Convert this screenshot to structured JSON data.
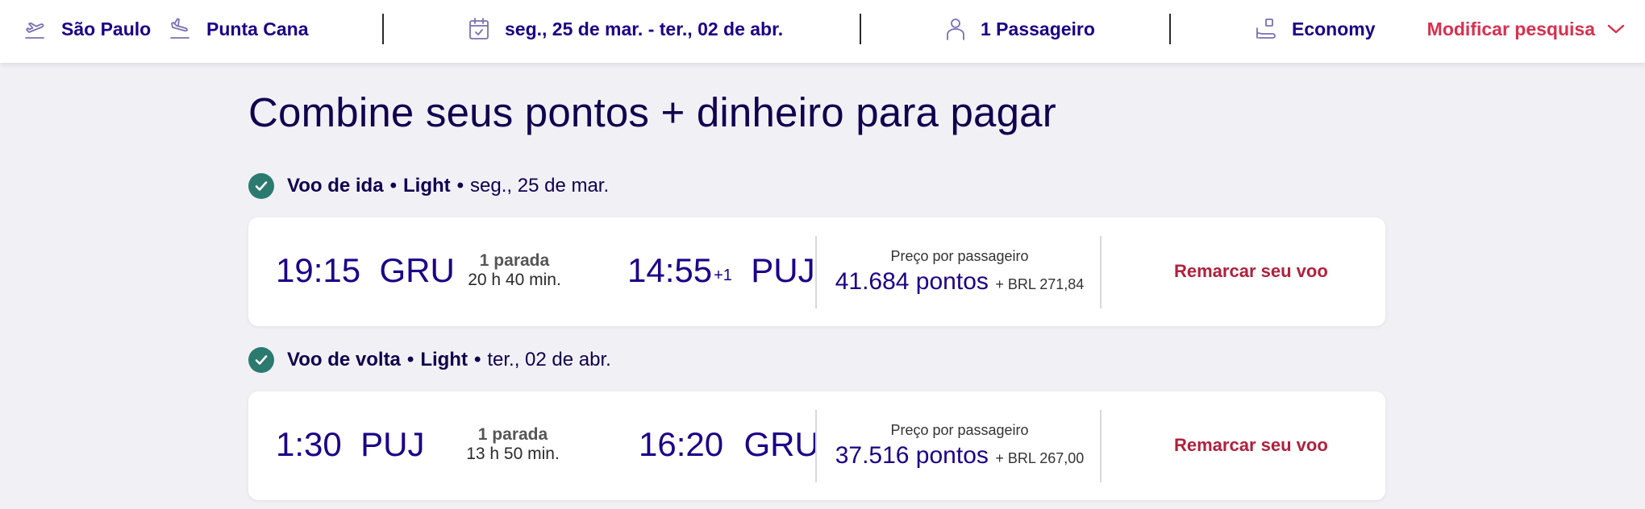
{
  "search": {
    "origin": "São Paulo",
    "destination": "Punta Cana",
    "dates": "seg., 25 de mar. - ter., 02 de abr.",
    "passengers": "1 Passageiro",
    "cabin": "Economy",
    "modify_label": "Modificar pesquisa"
  },
  "page": {
    "title": "Combine seus pontos + dinheiro para pagar"
  },
  "flights": [
    {
      "label_type": "Voo de ida",
      "label_fare": "Light",
      "label_date": "seg., 25 de mar.",
      "depart_time": "19:15",
      "depart_airport": "GRU",
      "stops": "1 parada",
      "duration": "20 h 40 min.",
      "arrive_time": "14:55",
      "arrive_day_offset": "+1",
      "arrive_airport": "PUJ",
      "price_label": "Preço por passageiro",
      "price_points": "41.684 pontos",
      "price_cash": "+ BRL 271,84",
      "rebook_label": "Remarcar seu voo"
    },
    {
      "label_type": "Voo de volta",
      "label_fare": "Light",
      "label_date": "ter., 02 de abr.",
      "depart_time": "1:30",
      "depart_airport": "PUJ",
      "stops": "1 parada",
      "duration": "13 h 50 min.",
      "arrive_time": "16:20",
      "arrive_day_offset": "",
      "arrive_airport": "GRU",
      "price_label": "Preço por passageiro",
      "price_points": "37.516 pontos",
      "price_cash": "+ BRL 267,00",
      "rebook_label": "Remarcar seu voo"
    }
  ],
  "separator_dot": "•",
  "icons": {
    "origin": "plane-takeoff-icon",
    "destination": "plane-landing-icon",
    "dates": "calendar-icon",
    "passengers": "person-icon",
    "cabin": "seat-icon",
    "modify": "chevron-down-icon",
    "segment_status": "check-circle-icon"
  },
  "colors": {
    "accent_red": "#d8304f",
    "rebook_red": "#b0203c",
    "navy": "#1b0088",
    "check_green": "#2b7a6f",
    "background": "#f1f0f5"
  }
}
